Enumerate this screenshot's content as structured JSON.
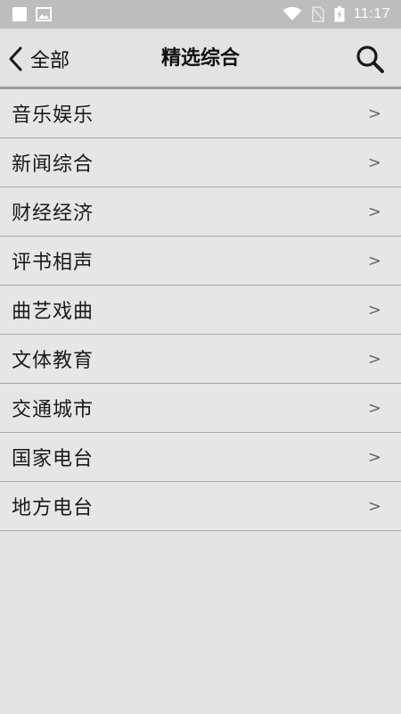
{
  "status_bar": {
    "time": "11:17",
    "icons": [
      "notification-square-icon",
      "image-icon",
      "wifi-icon",
      "no-sim-icon",
      "battery-icon"
    ]
  },
  "header": {
    "back_label": "全部",
    "title": "精选综合",
    "search_icon": "search-icon"
  },
  "list": {
    "arrow": ">",
    "items": [
      {
        "label": "音乐娱乐"
      },
      {
        "label": "新闻综合"
      },
      {
        "label": "财经经济"
      },
      {
        "label": "评书相声"
      },
      {
        "label": "曲艺戏曲"
      },
      {
        "label": "文体教育"
      },
      {
        "label": "交通城市"
      },
      {
        "label": "国家电台"
      },
      {
        "label": "地方电台"
      }
    ]
  },
  "colors": {
    "background": "#e3e3e3",
    "status_bar": "#bdbdbd",
    "divider": "#a8a8a8"
  }
}
